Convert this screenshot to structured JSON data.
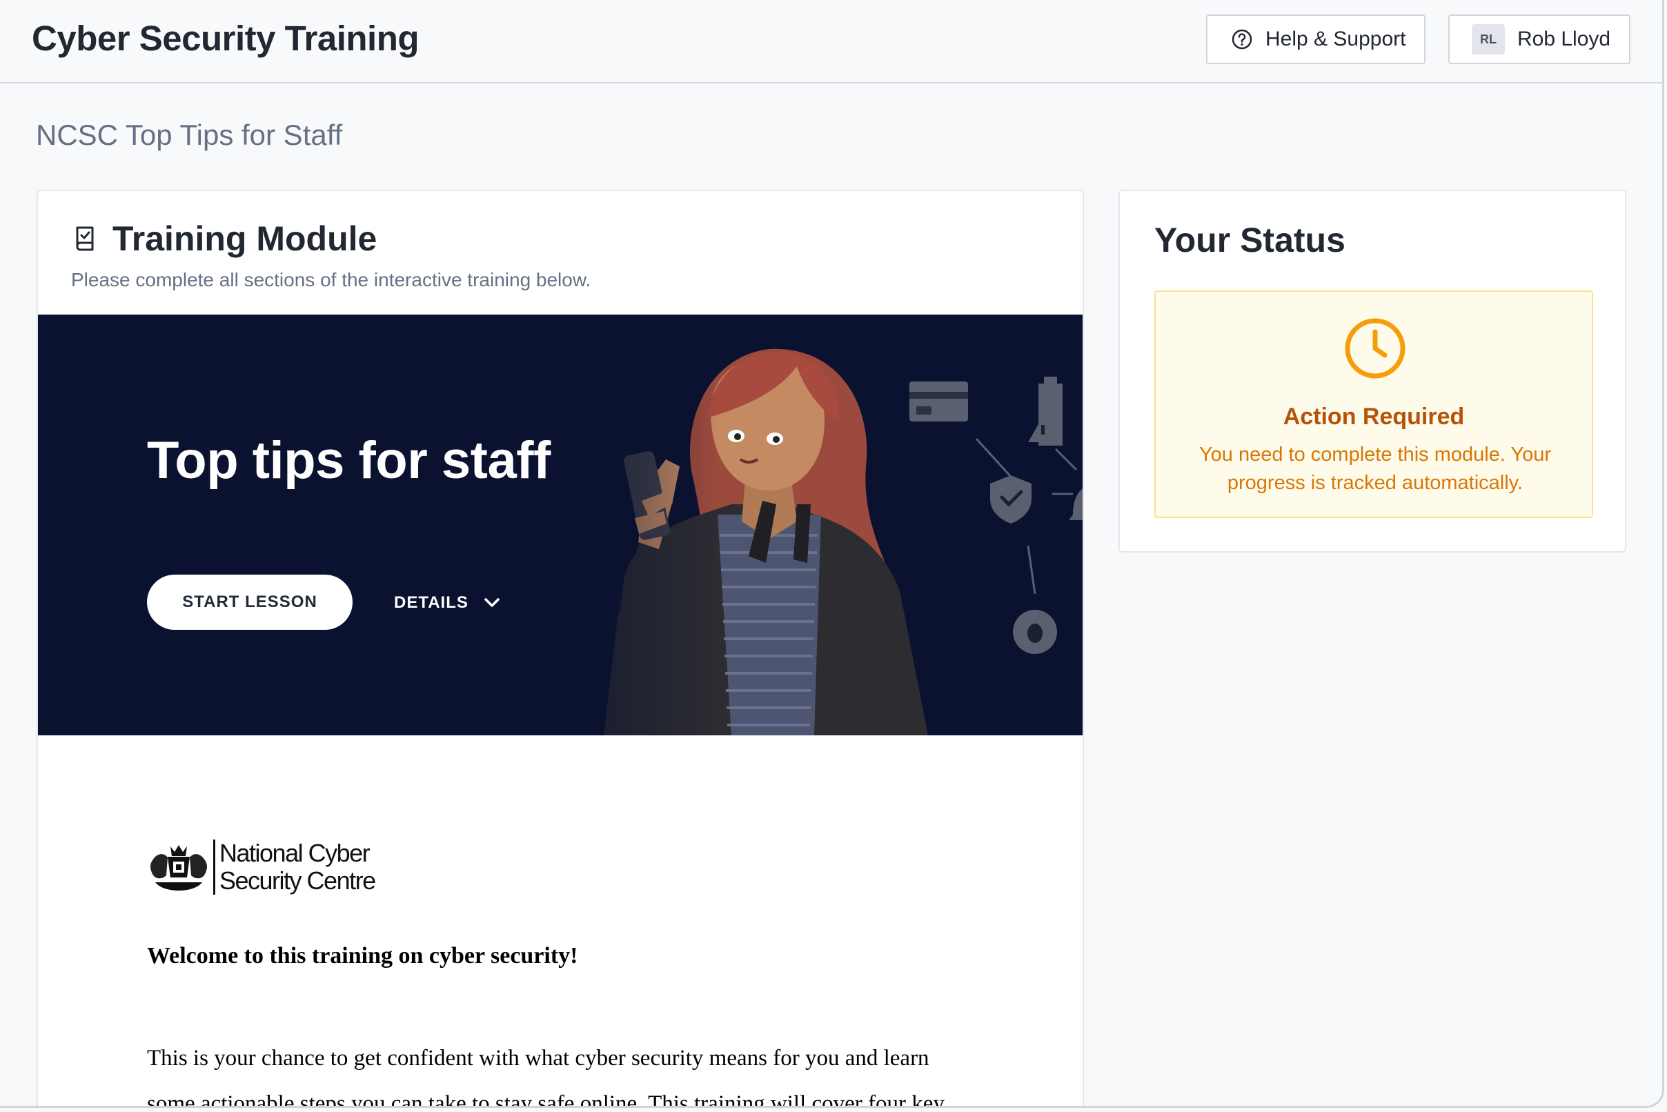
{
  "header": {
    "app_title": "Cyber Security Training",
    "help_label": "Help & Support",
    "user_initials": "RL",
    "user_name": "Rob Lloyd"
  },
  "page": {
    "title": "NCSC Top Tips for Staff"
  },
  "module": {
    "title": "Training Module",
    "subtitle": "Please complete all sections of the interactive training below.",
    "banner": {
      "title": "Top tips for staff",
      "start_label": "START LESSON",
      "details_label": "DETAILS"
    },
    "content": {
      "logo_line1": "National Cyber",
      "logo_line2": "Security Centre",
      "welcome": "Welcome to this training on cyber security!",
      "paragraph": "This is your chance to get confident with what cyber security means for you and learn some actionable steps you can take to stay safe online. This training will cover four key"
    }
  },
  "status": {
    "title": "Your Status",
    "state_label": "Action Required",
    "message": "You need to complete this module. Your progress is tracked automatically."
  },
  "colors": {
    "banner_bg": "#0b1230",
    "warning_text": "#b45309",
    "warning_accent": "#f59e0b",
    "warning_bg": "#fefbea"
  },
  "icons": {
    "help": "help-circle-icon",
    "module": "book-check-icon",
    "status": "clock-icon",
    "details": "chevron-down-icon"
  }
}
